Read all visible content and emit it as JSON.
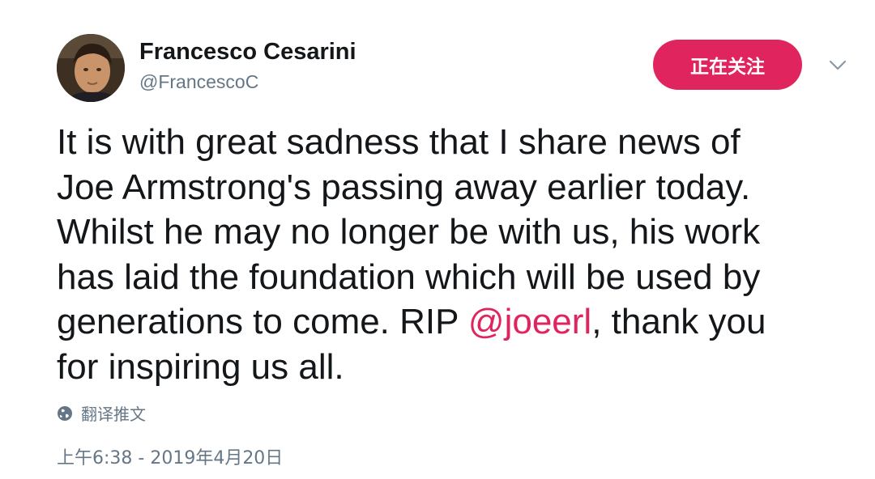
{
  "author": {
    "name": "Francesco Cesarini",
    "handle": "@FrancescoC"
  },
  "follow_button": {
    "label": "正在关注"
  },
  "tweet": {
    "lines": [
      "It is with great sadness that I share news of",
      "Joe Armstrong's passing away earlier today.",
      "Whilst he may no longer be with us, his work",
      "has laid the foundation which will be used by"
    ],
    "line5_before": "generations to come. RIP ",
    "mention": "@joeerl",
    "line5_after": ", thank you",
    "line6": "for inspiring us all."
  },
  "translate": {
    "label": "翻译推文",
    "icon": "globe-icon"
  },
  "timestamp": "上午6:38 - 2019年4月20日",
  "colors": {
    "accent": "#e0245e",
    "secondary_text": "#657786",
    "primary_text": "#14171a"
  }
}
